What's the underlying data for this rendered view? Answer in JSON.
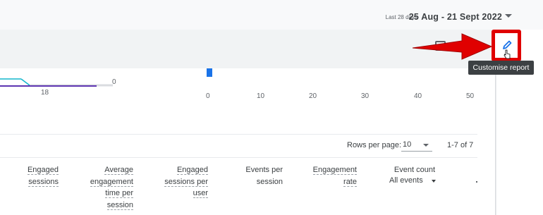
{
  "date": {
    "period_label": "Last 28 days",
    "range": "25 Aug - 21 Sept 2022"
  },
  "toolbar": {
    "tooltip": "Customise report"
  },
  "chart": {
    "left_ticks": [
      "0",
      "18"
    ],
    "x_ticks": [
      "0",
      "10",
      "20",
      "30",
      "40",
      "50"
    ]
  },
  "pagination": {
    "rows_label": "Rows per page:",
    "rows_value": "10",
    "range": "1-7 of 7"
  },
  "table": {
    "columns": [
      {
        "lines": [
          "Engaged",
          "sessions"
        ]
      },
      {
        "lines": [
          "Average",
          "engagement",
          "time per",
          "session"
        ]
      },
      {
        "lines": [
          "Engaged",
          "sessions per",
          "user"
        ]
      },
      {
        "lines": [
          "Events per",
          "session"
        ]
      },
      {
        "lines": [
          "Engagement",
          "rate"
        ]
      },
      {
        "lines": [
          "Event count"
        ]
      }
    ],
    "event_filter": "All events"
  },
  "colors": {
    "accent_red": "#e00000",
    "blue": "#1a73e8",
    "purple_line": "#5e35b1",
    "teal_line": "#12b5cb"
  }
}
